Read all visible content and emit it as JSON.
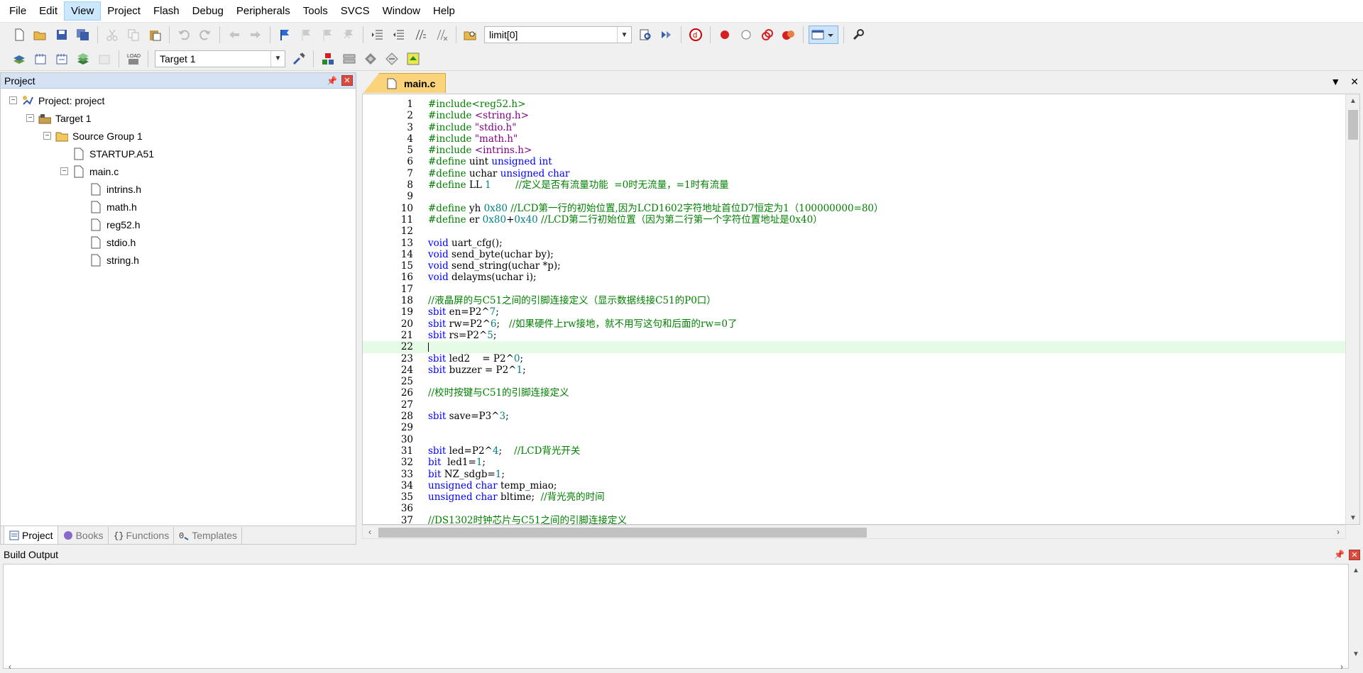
{
  "menubar": {
    "items": [
      "File",
      "Edit",
      "View",
      "Project",
      "Flash",
      "Debug",
      "Peripherals",
      "Tools",
      "SVCS",
      "Window",
      "Help"
    ],
    "active": "View"
  },
  "toolbar1": {
    "find_combo_value": "limit[0]"
  },
  "toolbar2": {
    "target_combo_value": "Target 1"
  },
  "project_panel": {
    "title": "Project",
    "tree": [
      {
        "label": "Project: project",
        "level": 0,
        "icon": "project-icon",
        "expander": "−"
      },
      {
        "label": "Target 1",
        "level": 1,
        "icon": "target-icon",
        "expander": "−"
      },
      {
        "label": "Source Group 1",
        "level": 2,
        "icon": "folder-icon",
        "expander": "−"
      },
      {
        "label": "STARTUP.A51",
        "level": 3,
        "icon": "file-icon",
        "expander": ""
      },
      {
        "label": "main.c",
        "level": 3,
        "icon": "file-icon",
        "expander": "−"
      },
      {
        "label": "intrins.h",
        "level": 4,
        "icon": "file-icon",
        "expander": ""
      },
      {
        "label": "math.h",
        "level": 4,
        "icon": "file-icon",
        "expander": ""
      },
      {
        "label": "reg52.h",
        "level": 4,
        "icon": "file-icon",
        "expander": ""
      },
      {
        "label": "stdio.h",
        "level": 4,
        "icon": "file-icon",
        "expander": ""
      },
      {
        "label": "string.h",
        "level": 4,
        "icon": "file-icon",
        "expander": ""
      }
    ],
    "tabs": [
      {
        "label": "Project",
        "icon": "project-tab-icon",
        "active": true
      },
      {
        "label": "Books",
        "icon": "books-icon",
        "active": false
      },
      {
        "label": "Functions",
        "icon": "functions-icon",
        "active": false
      },
      {
        "label": "Templates",
        "icon": "templates-icon",
        "active": false
      }
    ]
  },
  "editor": {
    "tab_label": "main.c",
    "current_line": 22,
    "lines": [
      {
        "n": 1,
        "t": [
          [
            "pp",
            "#include<reg52.h>"
          ]
        ]
      },
      {
        "n": 2,
        "t": [
          [
            "pp",
            "#include "
          ],
          [
            "str",
            "<string.h>"
          ]
        ]
      },
      {
        "n": 3,
        "t": [
          [
            "pp",
            "#include "
          ],
          [
            "str",
            "\"stdio.h\""
          ]
        ]
      },
      {
        "n": 4,
        "t": [
          [
            "pp",
            "#include "
          ],
          [
            "str",
            "\"math.h\""
          ]
        ]
      },
      {
        "n": 5,
        "t": [
          [
            "pp",
            "#include "
          ],
          [
            "str",
            "<intrins.h>"
          ]
        ]
      },
      {
        "n": 6,
        "t": [
          [
            "pp",
            "#define "
          ],
          [
            "pl",
            "uint "
          ],
          [
            "kw",
            "unsigned int"
          ]
        ]
      },
      {
        "n": 7,
        "t": [
          [
            "pp",
            "#define "
          ],
          [
            "pl",
            "uchar "
          ],
          [
            "kw",
            "unsigned char"
          ]
        ]
      },
      {
        "n": 8,
        "t": [
          [
            "pp",
            "#define "
          ],
          [
            "pl",
            "LL "
          ],
          [
            "num",
            "1"
          ],
          [
            "cm",
            "        //定义是否有流量功能  =0时无流量，=1时有流量"
          ]
        ]
      },
      {
        "n": 9,
        "t": []
      },
      {
        "n": 10,
        "t": [
          [
            "pp",
            "#define "
          ],
          [
            "pl",
            "yh "
          ],
          [
            "num",
            "0x80"
          ],
          [
            "cm",
            " //LCD第一行的初始位置,因为LCD1602字符地址首位D7恒定为1（100000000=80）"
          ]
        ]
      },
      {
        "n": 11,
        "t": [
          [
            "pp",
            "#define "
          ],
          [
            "pl",
            "er "
          ],
          [
            "num",
            "0x80"
          ],
          [
            "pl",
            "+"
          ],
          [
            "num",
            "0x40"
          ],
          [
            "cm",
            " //LCD第二行初始位置（因为第二行第一个字符位置地址是0x40）"
          ]
        ]
      },
      {
        "n": 12,
        "t": []
      },
      {
        "n": 13,
        "t": [
          [
            "kw",
            "void "
          ],
          [
            "pl",
            "uart_cfg();"
          ]
        ]
      },
      {
        "n": 14,
        "t": [
          [
            "kw",
            "void "
          ],
          [
            "pl",
            "send_byte(uchar by);"
          ]
        ]
      },
      {
        "n": 15,
        "t": [
          [
            "kw",
            "void "
          ],
          [
            "pl",
            "send_string(uchar *p);"
          ]
        ]
      },
      {
        "n": 16,
        "t": [
          [
            "kw",
            "void "
          ],
          [
            "pl",
            "delayms(uchar i);"
          ]
        ]
      },
      {
        "n": 17,
        "t": []
      },
      {
        "n": 18,
        "t": [
          [
            "cm",
            "//液晶屏的与C51之间的引脚连接定义（显示数据线接C51的P0口）"
          ]
        ]
      },
      {
        "n": 19,
        "t": [
          [
            "kw",
            "sbit "
          ],
          [
            "pl",
            "en=P2^"
          ],
          [
            "num",
            "7"
          ],
          [
            "pl",
            ";"
          ]
        ]
      },
      {
        "n": 20,
        "t": [
          [
            "kw",
            "sbit "
          ],
          [
            "pl",
            "rw=P2^"
          ],
          [
            "num",
            "6"
          ],
          [
            "pl",
            ";   "
          ],
          [
            "cm",
            "//如果硬件上rw接地，就不用写这句和后面的rw=0了"
          ]
        ]
      },
      {
        "n": 21,
        "t": [
          [
            "kw",
            "sbit "
          ],
          [
            "pl",
            "rs=P2^"
          ],
          [
            "num",
            "5"
          ],
          [
            "pl",
            ";"
          ]
        ]
      },
      {
        "n": 22,
        "t": []
      },
      {
        "n": 23,
        "t": [
          [
            "kw",
            "sbit "
          ],
          [
            "pl",
            "led2    = P2^"
          ],
          [
            "num",
            "0"
          ],
          [
            "pl",
            ";"
          ]
        ]
      },
      {
        "n": 24,
        "t": [
          [
            "kw",
            "sbit "
          ],
          [
            "pl",
            "buzzer = P2^"
          ],
          [
            "num",
            "1"
          ],
          [
            "pl",
            ";"
          ]
        ]
      },
      {
        "n": 25,
        "t": []
      },
      {
        "n": 26,
        "t": [
          [
            "cm",
            "//校时按键与C51的引脚连接定义"
          ]
        ]
      },
      {
        "n": 27,
        "t": []
      },
      {
        "n": 28,
        "t": [
          [
            "kw",
            "sbit "
          ],
          [
            "pl",
            "save=P3^"
          ],
          [
            "num",
            "3"
          ],
          [
            "pl",
            ";"
          ]
        ]
      },
      {
        "n": 29,
        "t": []
      },
      {
        "n": 30,
        "t": []
      },
      {
        "n": 31,
        "t": [
          [
            "kw",
            "sbit "
          ],
          [
            "pl",
            "led=P2^"
          ],
          [
            "num",
            "4"
          ],
          [
            "pl",
            ";    "
          ],
          [
            "cm",
            "//LCD背光开关"
          ]
        ]
      },
      {
        "n": 32,
        "t": [
          [
            "kw",
            "bit  "
          ],
          [
            "pl",
            "led1="
          ],
          [
            "num",
            "1"
          ],
          [
            "pl",
            ";"
          ]
        ]
      },
      {
        "n": 33,
        "t": [
          [
            "kw",
            "bit "
          ],
          [
            "pl",
            "NZ_sdgb="
          ],
          [
            "num",
            "1"
          ],
          [
            "pl",
            ";"
          ]
        ]
      },
      {
        "n": 34,
        "t": [
          [
            "kw",
            "unsigned char "
          ],
          [
            "pl",
            "temp_miao;"
          ]
        ]
      },
      {
        "n": 35,
        "t": [
          [
            "kw",
            "unsigned char "
          ],
          [
            "pl",
            "bltime;  "
          ],
          [
            "cm",
            "//背光亮的时间"
          ]
        ]
      },
      {
        "n": 36,
        "t": []
      },
      {
        "n": 37,
        "t": [
          [
            "cm",
            "//DS1302时钟芯片与C51之间的引脚连接定义"
          ]
        ]
      }
    ]
  },
  "build_output": {
    "title": "Build Output"
  },
  "colors": {
    "preprocessor": "#008000",
    "string": "#800080",
    "keyword": "#0000ff",
    "number": "#008080",
    "comment": "#008000",
    "current_line_bg": "#e6fbe6",
    "tab_active": "#fbd37a",
    "panel_header": "#d4e2f4"
  }
}
